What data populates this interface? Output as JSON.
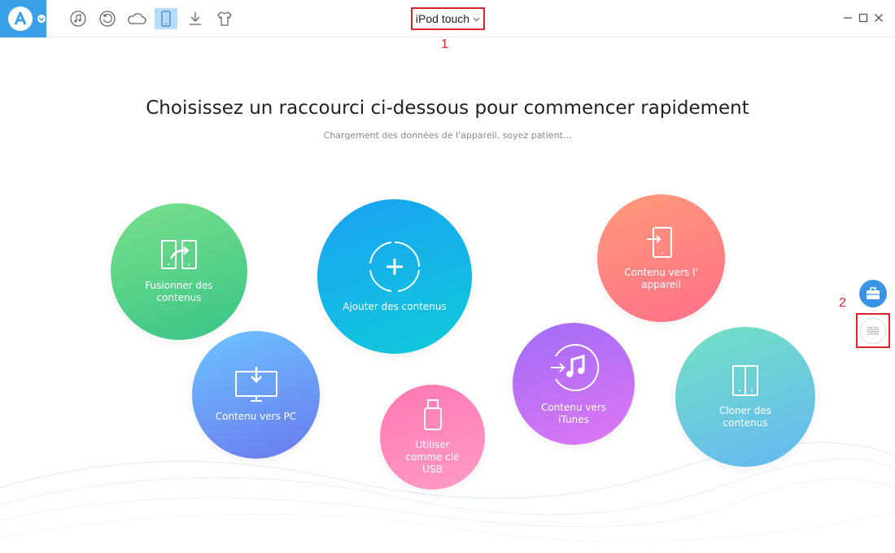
{
  "header": {
    "device_label": "iPod touch",
    "annotation_1": "1",
    "annotation_2": "2"
  },
  "toolbar": {
    "icons": [
      "music-icon",
      "history-icon",
      "cloud-icon",
      "device-icon",
      "download-icon",
      "tshirt-icon"
    ],
    "active": "device-icon"
  },
  "main": {
    "title": "Choisissez un raccourci ci-dessous pour commencer rapidement",
    "subtitle": "Chargement des données de l'appareil, soyez patient..."
  },
  "shortcuts": {
    "fusion": "Fusionner des contenus",
    "ajouter": "Ajouter des contenus",
    "pc": "Contenu vers PC",
    "usb": "Utiliser comme clé USB",
    "appareil": "Contenu vers l' appareil",
    "itunes": "Contenu vers iTunes",
    "cloner": "Cloner des contenus"
  },
  "colors": {
    "accent": "#3aa0e8",
    "annotation": "#d9262c"
  }
}
